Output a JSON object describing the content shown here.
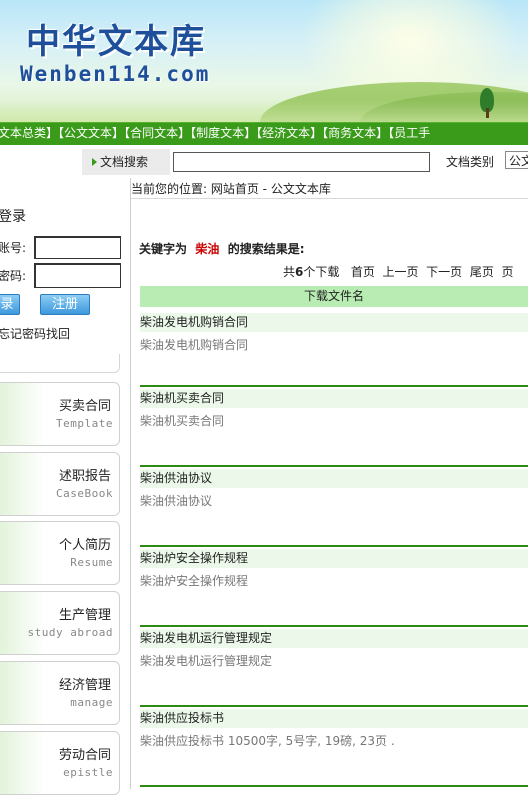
{
  "header": {
    "logo_cn": "中华文本库",
    "logo_en": "Wenben114.com"
  },
  "nav": {
    "items": [
      "文本总类",
      "公文文本",
      "合同文本",
      "制度文本",
      "经济文本",
      "商务文本",
      "员工手"
    ]
  },
  "search": {
    "label": "文档搜索",
    "value": "",
    "doctype_label": "文档类别",
    "doctype_value": "公文"
  },
  "login": {
    "title": "登录",
    "account_label": "账号:",
    "password_label": "密码:",
    "login_button": "录",
    "register_button": "注册",
    "forgot": "忘记密码找回"
  },
  "categories": [
    {
      "name": "买卖合同",
      "sub": "Template"
    },
    {
      "name": "述职报告",
      "sub": "CaseBook"
    },
    {
      "name": "个人简历",
      "sub": "Resume"
    },
    {
      "name": "生产管理",
      "sub": "study abroad"
    },
    {
      "name": "经济管理",
      "sub": "manage"
    },
    {
      "name": "劳动合同",
      "sub": "epistle"
    }
  ],
  "breadcrumb": "当前您的位置: 网站首页 - 公文文本库",
  "results_header": {
    "prefix": "关键字为",
    "keyword": "柴油",
    "suffix": "的搜索结果是:"
  },
  "pager": {
    "total_prefix": "共",
    "total_count": "6",
    "total_suffix": "个下载",
    "first": "首页",
    "prev": "上一页",
    "next": "下一页",
    "last": "尾页",
    "page": "页"
  },
  "table": {
    "column_header": "下载文件名"
  },
  "results": [
    {
      "title": "柴油发电机购销合同",
      "desc": "柴油发电机购销合同"
    },
    {
      "title": "柴油机买卖合同",
      "desc": "柴油机买卖合同"
    },
    {
      "title": "柴油供油协议",
      "desc": "柴油供油协议"
    },
    {
      "title": "柴油炉安全操作规程",
      "desc": "柴油炉安全操作规程"
    },
    {
      "title": "柴油发电机运行管理规定",
      "desc": "柴油发电机运行管理规定"
    },
    {
      "title": "柴油供应投标书",
      "desc": "柴油供应投标书 10500字, 5号字, 19磅, 23页 ."
    }
  ],
  "colors": {
    "nav_green": "#3a9a1a",
    "header_row": "#b9ecb3",
    "keyword_red": "#cc0000",
    "logo_blue": "#1d4f9a"
  }
}
